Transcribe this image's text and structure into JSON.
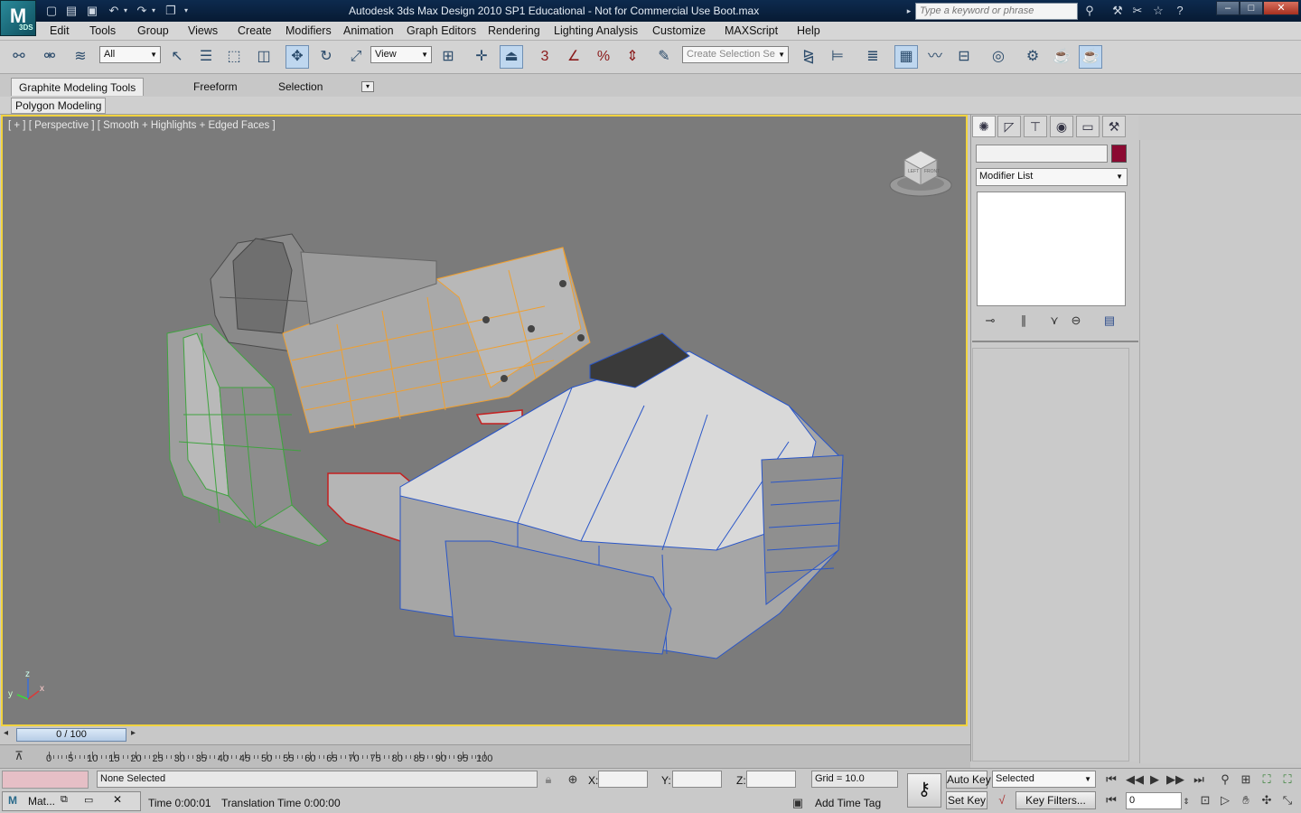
{
  "window": {
    "title": "Autodesk 3ds Max Design 2010 SP1   Educational - Not for Commercial Use     Boot.max",
    "search_placeholder": "Type a keyword or phrase",
    "logo_text": "M",
    "logo_sub": "3DS"
  },
  "menu": [
    "Edit",
    "Tools",
    "Group",
    "Views",
    "Create",
    "Modifiers",
    "Animation",
    "Graph Editors",
    "Rendering",
    "Lighting Analysis",
    "Customize",
    "MAXScript",
    "Help"
  ],
  "toolbar": {
    "selection_filter": "All",
    "reference_coord": "View",
    "named_selection_placeholder": "Create Selection Se",
    "snap_label": "3"
  },
  "ribbon": {
    "tabs": [
      "Graphite Modeling Tools",
      "Freeform",
      "Selection"
    ],
    "panel_button": "Polygon Modeling"
  },
  "viewport": {
    "label": "[ + ] [ Perspective ] [ Smooth + Highlights + Edged Faces ]",
    "axis_z": "z",
    "axis_x": "x",
    "axis_y": "y",
    "cube_left": "LEFT",
    "cube_front": "FRONT"
  },
  "command_panel": {
    "modifier_list": "Modifier List",
    "object_color": "#8b0a32"
  },
  "timeline": {
    "frame_display": "0 / 100",
    "ticks": [
      "0",
      "5",
      "10",
      "15",
      "20",
      "25",
      "30",
      "35",
      "40",
      "45",
      "50",
      "55",
      "60",
      "65",
      "70",
      "75",
      "80",
      "85",
      "90",
      "95",
      "100"
    ]
  },
  "status": {
    "maxscript_label": "Mat...",
    "selection_text": "None Selected",
    "render_time": "Time  0:00:01",
    "translation_time": "Translation Time  0:00:00",
    "x_label": "X:",
    "y_label": "Y:",
    "z_label": "Z:",
    "grid": "Grid = 10.0",
    "add_time_tag": "Add Time Tag",
    "auto_key": "Auto Key",
    "set_key": "Set Key",
    "key_filter_value": "Selected",
    "key_filters": "Key Filters...",
    "current_frame": "0"
  },
  "colors": {
    "accent": "#f1d33f",
    "viewport_bg": "#7b7b7b",
    "title_bg": "#0d2a4e"
  }
}
